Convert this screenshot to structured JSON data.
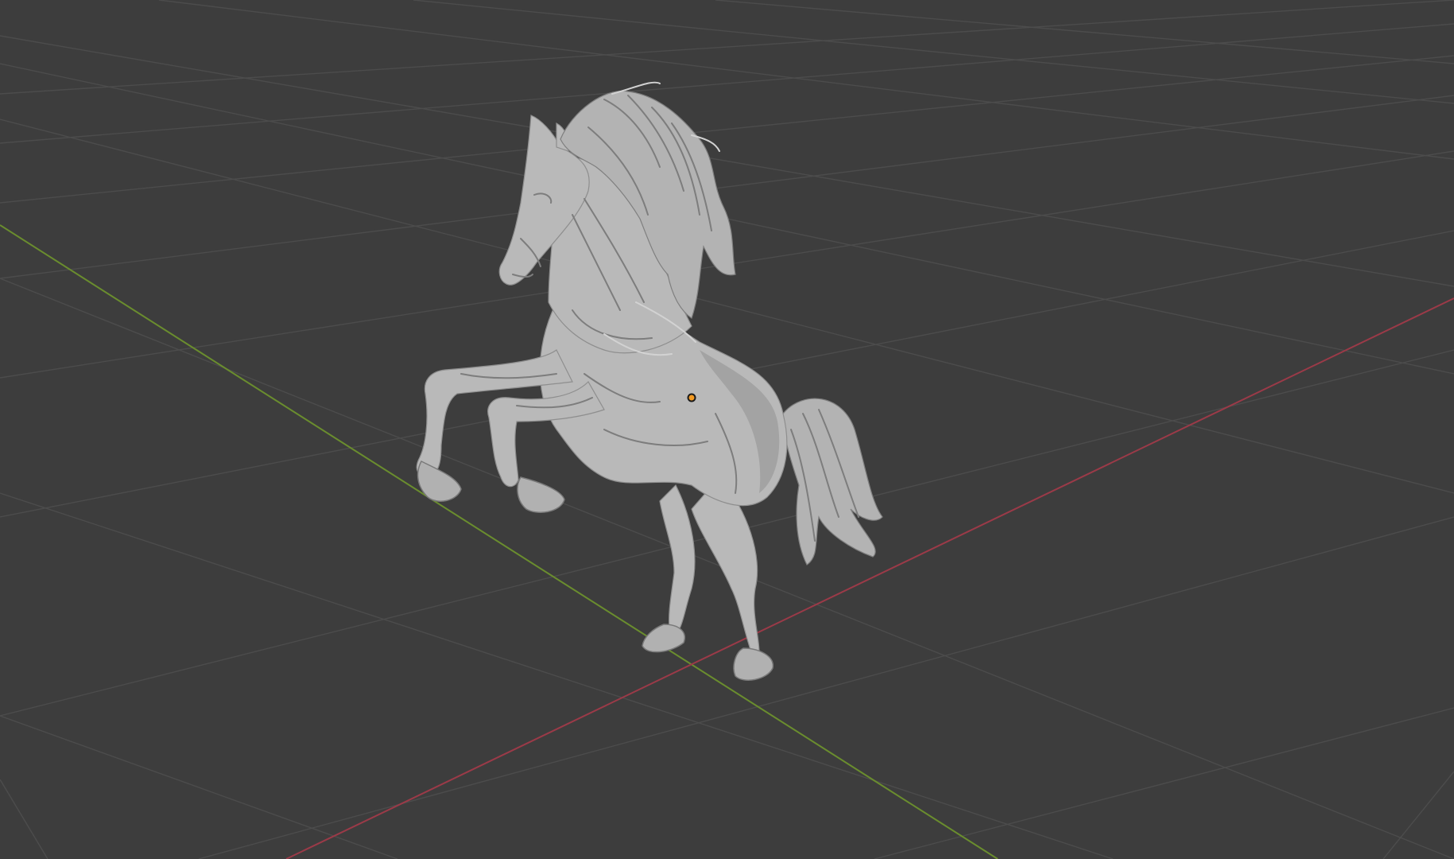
{
  "viewport": {
    "background": "#3d3d3d",
    "grid_color": "#4c4c4c",
    "x_axis_color": "#9b3a48",
    "y_axis_color": "#6a8d2e",
    "origin_color": "#f39a22"
  },
  "scene": {
    "object": "horse-sculpt-mesh",
    "shading": "solid",
    "selected": true
  }
}
